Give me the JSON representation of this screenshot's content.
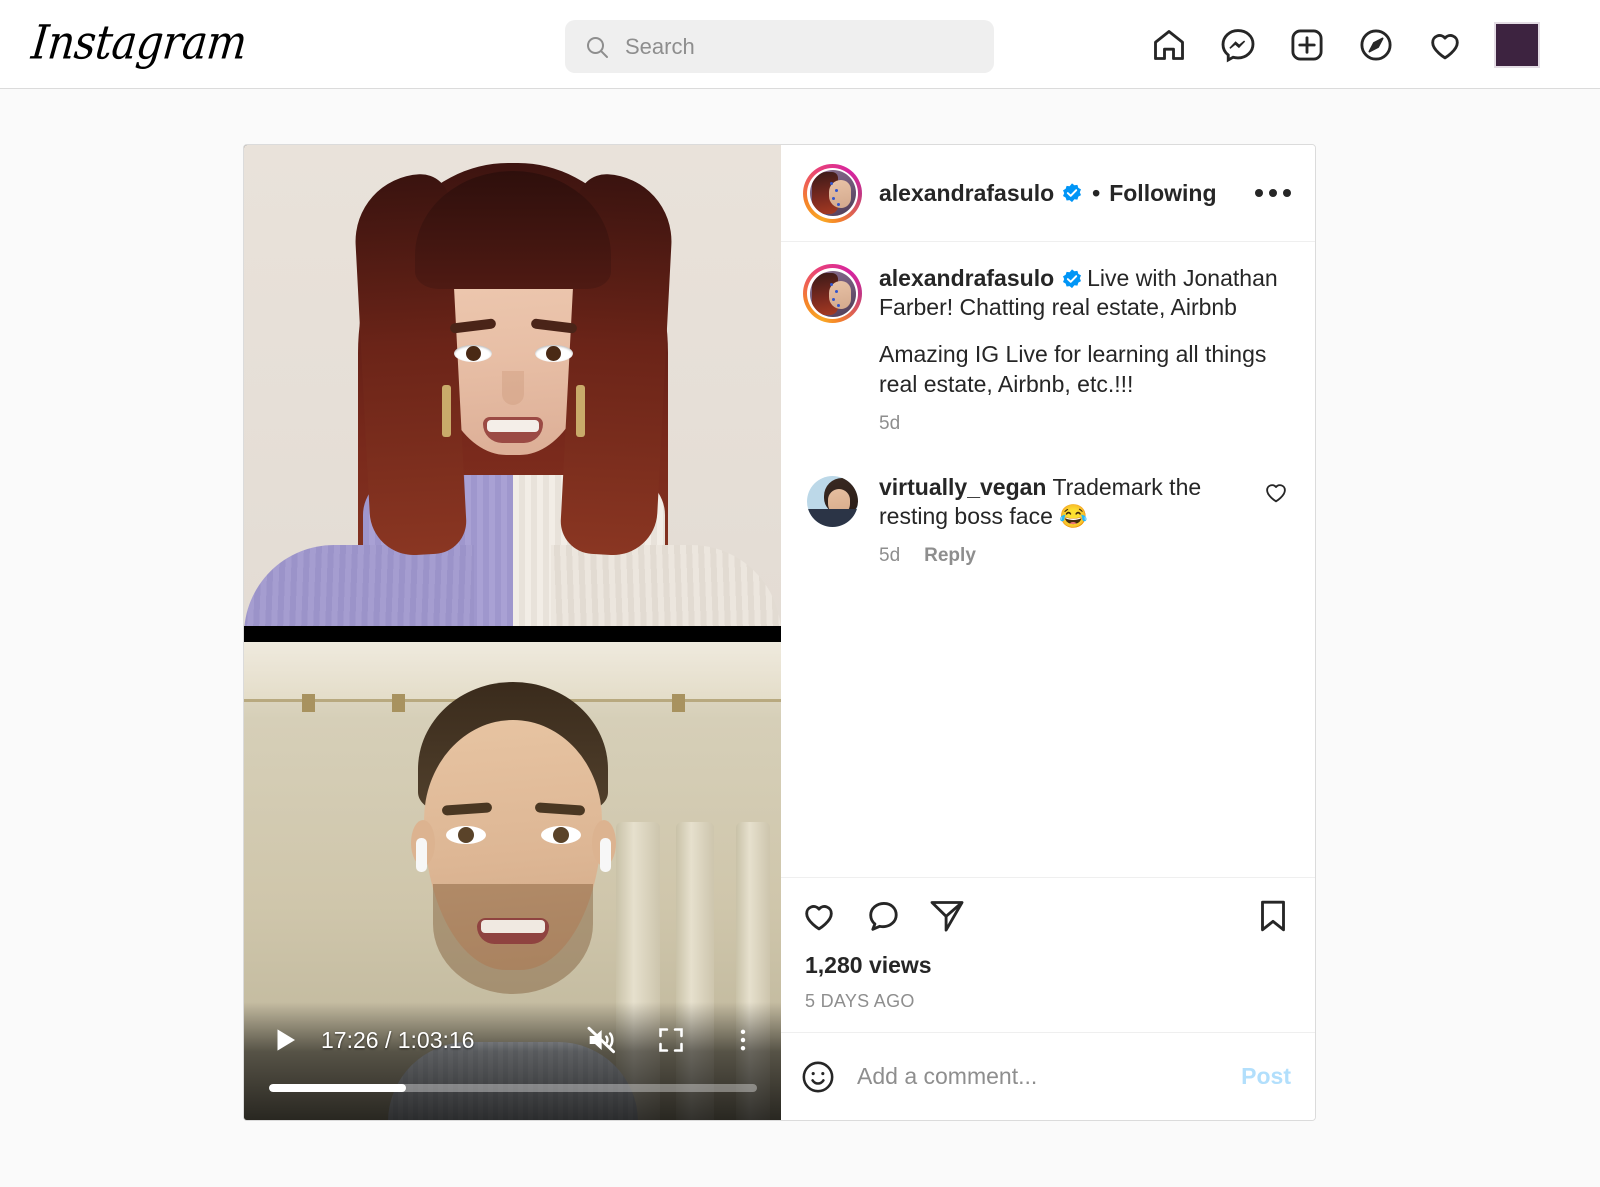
{
  "header": {
    "logo": "Instagram",
    "search": {
      "placeholder": "Search",
      "value": "",
      "icon": "search-icon"
    },
    "nav": [
      {
        "name": "home-icon",
        "label": "Home"
      },
      {
        "name": "messenger-icon",
        "label": "Messenger"
      },
      {
        "name": "new-post-icon",
        "label": "New post"
      },
      {
        "name": "explore-compass-icon",
        "label": "Explore"
      },
      {
        "name": "activity-heart-icon",
        "label": "Notifications"
      }
    ],
    "avatar_color": "#3d2340"
  },
  "post": {
    "author": {
      "username": "alexandrafasulo",
      "verified": true,
      "follow_state": "Following",
      "separator": "•"
    },
    "more_menu": "…",
    "caption": {
      "username": "alexandrafasulo",
      "line1": "Live with Jonathan Farber! Chatting real estate, Airbnb",
      "line2": "Amazing IG Live for learning all things real estate, Airbnb, etc.!!!",
      "time": "5d"
    },
    "comments": [
      {
        "username": "virtually_vegan",
        "text": "Trademark the resting boss face 😂",
        "time": "5d",
        "reply_label": "Reply"
      }
    ],
    "actions": {
      "like": "like-icon",
      "comment": "comment-icon",
      "share": "share-icon",
      "save": "save-icon"
    },
    "views": "1,280 views",
    "posted_ago": "5 DAYS AGO",
    "add_comment": {
      "placeholder": "Add a comment...",
      "value": "",
      "post_label": "Post",
      "emoji_icon": "emoji-smiley-icon"
    }
  },
  "video": {
    "current_time": "17:26",
    "separator": "/",
    "duration": "1:03:16",
    "time_display": "17:26 / 1:03:16",
    "progress_percent": 28,
    "muted": true,
    "playing": false,
    "controls": {
      "play": "play-icon",
      "mute": "volume-muted-icon",
      "fullscreen": "fullscreen-icon",
      "menu": "kebab-menu-icon"
    }
  },
  "colors": {
    "page_bg": "#fafafa",
    "card_bg": "#ffffff",
    "border": "#dbdbdb",
    "text": "#262626",
    "muted_text": "#8e8e8e",
    "link_blue": "#b2dffc",
    "verified_blue": "#0095f6"
  }
}
